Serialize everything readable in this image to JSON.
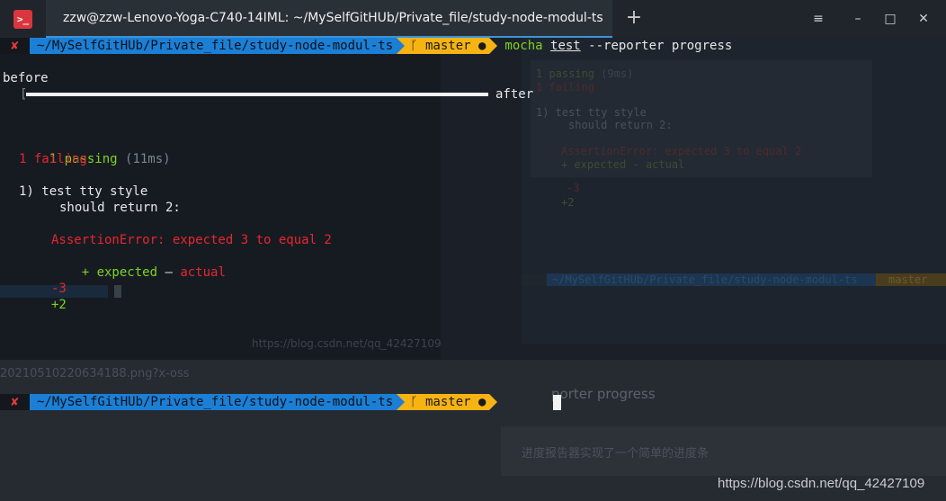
{
  "window": {
    "app_icon": ">_",
    "tab_title": "zzw@zzw-Lenovo-Yoga-C740-14IML: ~/MySelfGitHUb/Private_file/study-node-modul-ts",
    "new_tab": "+",
    "minimize": "–",
    "maximize": "□",
    "close": "✕",
    "hamburger": "≡"
  },
  "prompt1": {
    "status": "✘",
    "path": "~/MySelfGitHUb/Private_file/study-node-modul-ts",
    "branch": "ᚴ master ●",
    "cmd_program": "mocha",
    "cmd_arg": "test",
    "cmd_rest": " --reporter progress"
  },
  "output": {
    "before": "before",
    "bracket_open": "[",
    "after": "after",
    "passing": "1 passing",
    "passing_time": "(11ms)",
    "failing": "1 failing",
    "test_title": "1) test tty style",
    "test_case": "should return 2:",
    "assertion": "AssertionError: expected 3 to equal 2",
    "legend_expected": "+ expected",
    "legend_dash": " – ",
    "legend_actual": "actual",
    "minus": "-3",
    "plus": "+2"
  },
  "prompt2": {
    "status": "✘",
    "path": "~/MySelfGitHUb/Private_file/study-node-modul-ts",
    "branch": "ᚴ master ●"
  },
  "ghost_right": {
    "passing": "1 passing",
    "passing_time": "(9ms)",
    "failing": "1 failing",
    "test_title": "1) test tty style",
    "test_case": "should return 2:",
    "assertion": "AssertionError: expected 3 to equal 2",
    "legend": "+ expected - actual",
    "minus": "-3",
    "plus": "+2",
    "path": "~/MySelfGitHUb/Private_file/study-node-modul-ts",
    "branch": "master"
  },
  "ghost_bottom": {
    "url_fragment": "20210510220634188.png?x-oss",
    "heading": "porter progress",
    "subtext": "进度报告器实现了一个简单的进度条",
    "watermark1": "https://blog.csdn.net/qq_42427109",
    "watermark2": "https://blog.csdn.net/qq_42427109"
  },
  "colors": {
    "path_segment": "#1b7fd6",
    "branch_segment": "#f6b314",
    "pass": "#7ed321",
    "fail": "#e8262b",
    "tab_underline": "#3b93d9",
    "background": "#1b2028"
  },
  "progress": {
    "fraction": 1.0
  }
}
